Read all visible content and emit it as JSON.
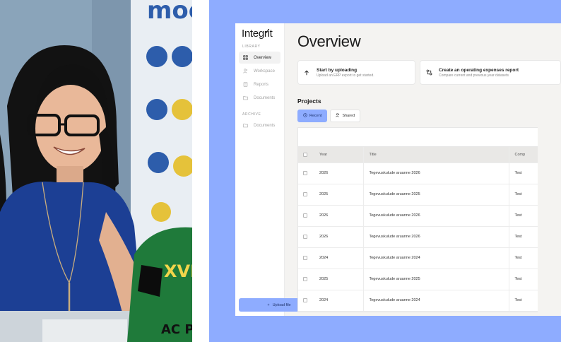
{
  "photo": {
    "sign_text": "moo",
    "shirt_text": "XVI",
    "shirt_text_bottom": "AC PC"
  },
  "sidebar": {
    "logo": "Integrit",
    "library_label": "LIBRARY",
    "items": [
      {
        "label": "Overview",
        "icon": "grid-icon",
        "active": true
      },
      {
        "label": "Workspace",
        "icon": "users-icon",
        "active": false
      },
      {
        "label": "Reports",
        "icon": "report-icon",
        "active": false
      },
      {
        "label": "Documents",
        "icon": "folder-icon",
        "active": false
      }
    ],
    "archive_label": "ARCHIVE",
    "archive_items": [
      {
        "label": "Documents",
        "icon": "folder-icon"
      }
    ],
    "upload_label": "Upload file"
  },
  "main": {
    "title": "Overview",
    "cards": [
      {
        "title": "Start by uploading",
        "subtitle": "Upload an ERP export to get started.",
        "icon": "arrow-up-icon"
      },
      {
        "title": "Create an operating expenses report",
        "subtitle": "Compare current and previous year datasets",
        "icon": "compare-icon"
      }
    ],
    "projects_title": "Projects",
    "tabs": [
      {
        "label": "Recent",
        "active": true
      },
      {
        "label": "Shared",
        "active": false
      }
    ],
    "table": {
      "columns": [
        "Year",
        "Title",
        "Comp"
      ],
      "rows": [
        {
          "year": "2026",
          "title": "Tegevuskulude aruanne 2026",
          "company": "Test"
        },
        {
          "year": "2025",
          "title": "Tegevuskulude aruanne 2025",
          "company": "Test"
        },
        {
          "year": "2026",
          "title": "Tegevuskulude aruanne 2026",
          "company": "Test"
        },
        {
          "year": "2026",
          "title": "Tegevuskulude aruanne 2026",
          "company": "Test"
        },
        {
          "year": "2024",
          "title": "Tegevuskulude aruanne 2024",
          "company": "Test"
        },
        {
          "year": "2025",
          "title": "Tegevuskulude aruanne 2025",
          "company": "Test"
        },
        {
          "year": "2024",
          "title": "Tegevuskulude aruanne 2024",
          "company": "Test"
        }
      ]
    }
  },
  "colors": {
    "accent": "#8eacff",
    "backdrop": "#8eacff",
    "app_bg": "#f4f3f1",
    "sidebar_bg": "#ffffff"
  }
}
